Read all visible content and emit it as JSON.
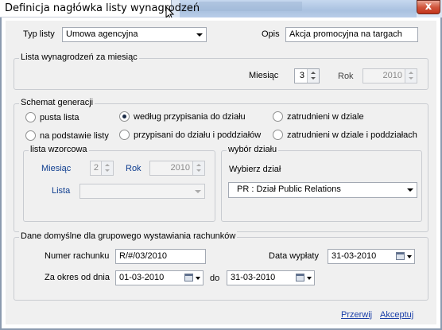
{
  "window": {
    "title": "Definicja nagłówka listy wynagrodzeń",
    "close_label": "x"
  },
  "top": {
    "typ_listy_label": "Typ listy",
    "typ_listy_value": "Umowa agencyjna",
    "opis_label": "Opis",
    "opis_value": "Akcja promocyjna na targach"
  },
  "lista_wynagrodzen": {
    "title": "Lista wynagrodzeń za miesiąc",
    "miesiac_label": "Miesiąc",
    "miesiac_value": "3",
    "rok_label": "Rok",
    "rok_value": "2010"
  },
  "schemat": {
    "title": "Schemat generacji",
    "options": [
      {
        "label": "pusta lista",
        "checked": false
      },
      {
        "label": "według przypisania do działu",
        "checked": true
      },
      {
        "label": "zatrudnieni w dziale",
        "checked": false
      },
      {
        "label": "na podstawie listy",
        "checked": false
      },
      {
        "label": "przypisani do działu i poddziałów",
        "checked": false
      },
      {
        "label": "zatrudnieni w dziale i poddziałach",
        "checked": false
      }
    ],
    "lista_wzorcowa": {
      "title": "lista wzorcowa",
      "miesiac_label": "Miesiąc",
      "miesiac_value": "2",
      "rok_label": "Rok",
      "rok_value": "2010",
      "lista_label": "Lista",
      "lista_value": ""
    },
    "wybor_dzialu": {
      "title": "wybór działu",
      "wybierz_label": "Wybierz dział",
      "dzial_value": "PR : Dział Public Relations"
    }
  },
  "dane_domyslne": {
    "title": "Dane domyślne dla grupowego wystawiania rachunków",
    "numer_label": "Numer rachunku",
    "numer_value": "R/#/03/2010",
    "data_wyplaty_label": "Data wypłaty",
    "data_wyplaty_value": "31-03-2010",
    "za_okres_label": "Za okres od dnia",
    "od_value": "01-03-2010",
    "do_label": "do",
    "do_value": "31-03-2010"
  },
  "actions": {
    "przerwij": "Przerwij",
    "akceptuj": "Akceptuj"
  }
}
